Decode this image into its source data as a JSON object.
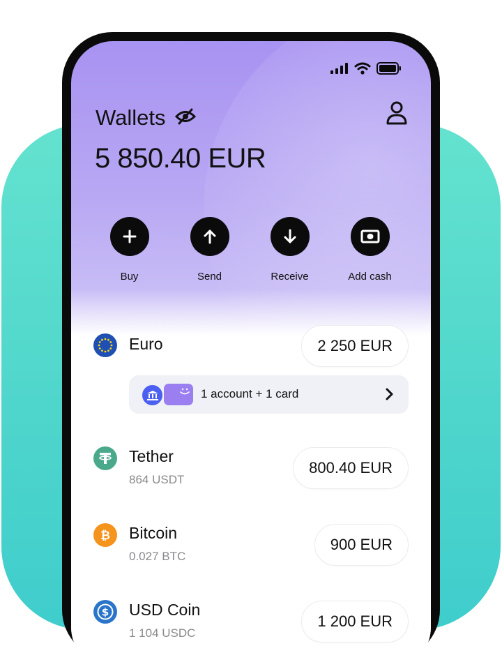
{
  "header": {
    "title": "Wallets",
    "balance": "5 850.40 EUR"
  },
  "status_bar": {
    "signal_icon": "signal-bars-icon",
    "wifi_icon": "wifi-icon",
    "battery_icon": "battery-icon"
  },
  "actions": [
    {
      "label": "Buy",
      "icon": "plus-icon"
    },
    {
      "label": "Send",
      "icon": "arrow-up-icon"
    },
    {
      "label": "Receive",
      "icon": "arrow-down-icon"
    },
    {
      "label": "Add cash",
      "icon": "banknote-icon"
    }
  ],
  "wallets": [
    {
      "name": "Euro",
      "sub": "",
      "amount": "2 250 EUR",
      "icon": "eu-flag-icon",
      "color": "#1f4fb3"
    },
    {
      "name": "Tether",
      "sub": "864 USDT",
      "amount": "800.40 EUR",
      "icon": "tether-icon",
      "color": "#4aa98a"
    },
    {
      "name": "Bitcoin",
      "sub": "0.027 BTC",
      "amount": "900 EUR",
      "icon": "bitcoin-icon",
      "color": "#f5941d"
    },
    {
      "name": "USD Coin",
      "sub": "1 104 USDC",
      "amount": "1 200 EUR",
      "icon": "usd-coin-icon",
      "color": "#2a74c9"
    }
  ],
  "euro_account": {
    "label": "1 account + 1 card"
  },
  "colors": {
    "teal_background": "#4fd6cc",
    "header_purple": "#a893f2",
    "button_black": "#0b0b0b"
  }
}
